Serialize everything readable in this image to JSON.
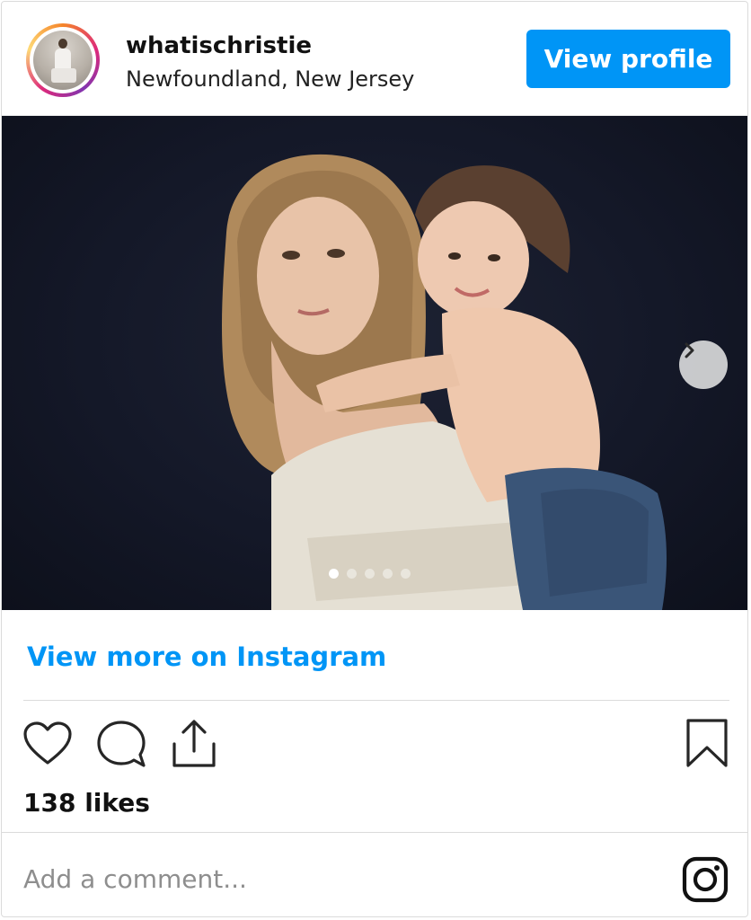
{
  "header": {
    "username": "whatischristie",
    "location": "Newfoundland, New Jersey",
    "view_profile_label": "View profile"
  },
  "post": {
    "carousel": {
      "slide_count": 5,
      "active_slide": 1
    }
  },
  "links": {
    "view_more_label": "View more on Instagram"
  },
  "engagement": {
    "likes_text": "138 likes"
  },
  "comment_box": {
    "placeholder": "Add a comment..."
  },
  "icons": {
    "like": "heart-icon",
    "comment": "comment-icon",
    "share": "share-icon",
    "save": "bookmark-icon",
    "brand": "instagram-icon",
    "carousel_next": "chevron-right-icon"
  },
  "colors": {
    "accent": "#0095f6",
    "border": "#dbdbdb",
    "muted_text": "#8e8e8e"
  }
}
